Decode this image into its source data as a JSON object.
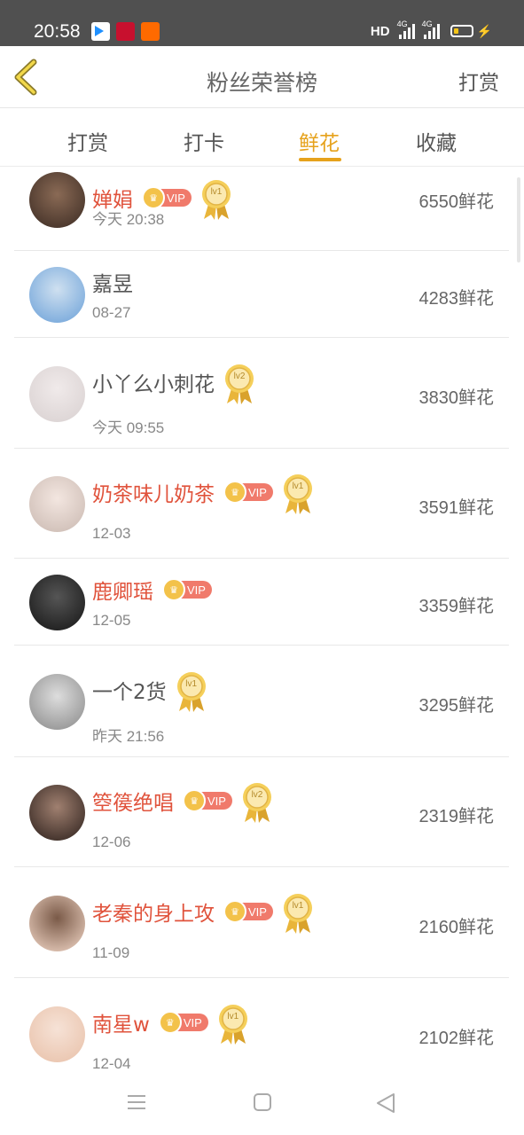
{
  "status_bar": {
    "time": "20:58",
    "hd_label": "HD",
    "network_1": "4G",
    "network_2": "4G",
    "app_icons": [
      "video-app-icon",
      "red-app-icon",
      "orange-app-icon"
    ]
  },
  "nav": {
    "title": "粉丝荣誉榜",
    "action_label": "打赏",
    "back_icon": "chevron-left-icon",
    "accent_color": "#e6a21c"
  },
  "tabs": [
    {
      "label": "打赏",
      "active": false
    },
    {
      "label": "打卡",
      "active": false
    },
    {
      "label": "鲜花",
      "active": true
    },
    {
      "label": "收藏",
      "active": false
    }
  ],
  "fans": [
    {
      "name": "婵娟",
      "vip": true,
      "medal": "lv1",
      "date": "今天 20:38",
      "amount": "6550鲜花"
    },
    {
      "name": "嘉昱",
      "vip": false,
      "medal": "",
      "date": "08-27",
      "amount": "4283鲜花"
    },
    {
      "name": "小丫么小刺花",
      "vip": false,
      "medal": "lv2",
      "date": "今天 09:55",
      "amount": "3830鲜花"
    },
    {
      "name": "奶茶味儿奶茶",
      "vip": true,
      "medal": "lv1",
      "date": "12-03",
      "amount": "3591鲜花"
    },
    {
      "name": "鹿卿瑶",
      "vip": true,
      "medal": "",
      "date": "12-05",
      "amount": "3359鲜花"
    },
    {
      "name": "一个2货",
      "vip": false,
      "medal": "lv1",
      "date": "昨天 21:56",
      "amount": "3295鲜花"
    },
    {
      "name": "箜篌绝唱",
      "vip": true,
      "medal": "lv2",
      "date": "12-06",
      "amount": "2319鲜花"
    },
    {
      "name": "老秦的身上攻",
      "vip": true,
      "medal": "lv1",
      "date": "11-09",
      "amount": "2160鲜花"
    },
    {
      "name": "南星w",
      "vip": true,
      "medal": "lv1",
      "date": "12-04",
      "amount": "2102鲜花"
    }
  ],
  "vip_label": "VIP",
  "bottom_nav": [
    "menu-icon",
    "home-square-icon",
    "back-triangle-icon"
  ]
}
